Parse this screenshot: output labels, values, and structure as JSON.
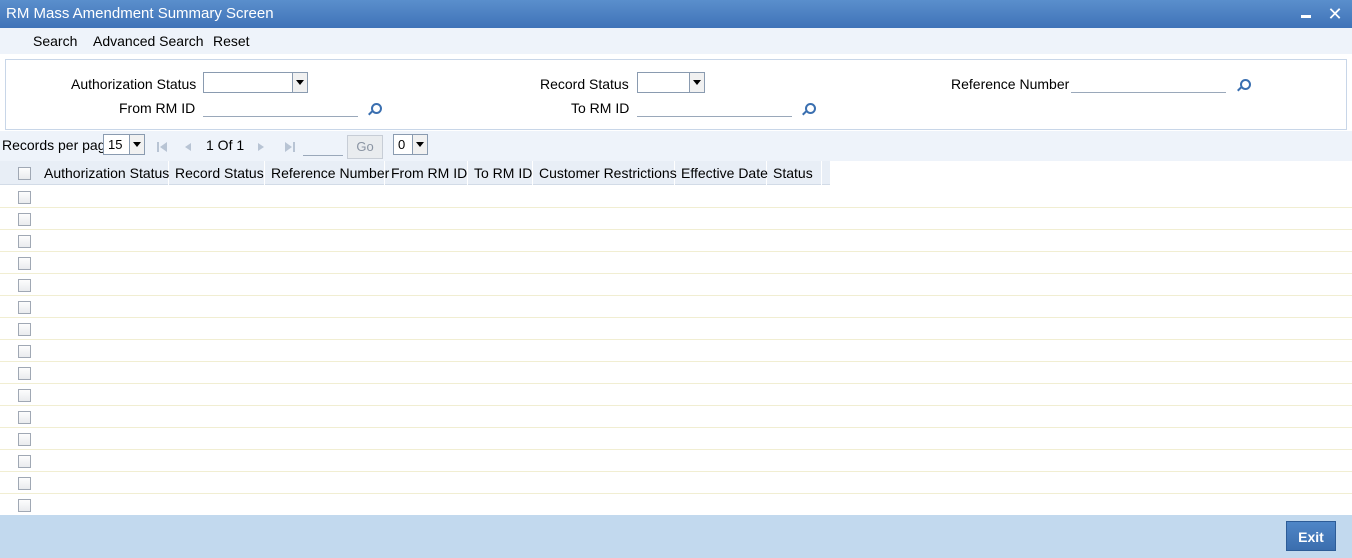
{
  "window": {
    "title": "RM Mass Amendment Summary Screen"
  },
  "menu": {
    "items": [
      "Search",
      "Advanced Search",
      "Reset"
    ]
  },
  "criteria": {
    "authorization_status_label": "Authorization Status",
    "authorization_status_value": "",
    "record_status_label": "Record Status",
    "record_status_value": "",
    "reference_number_label": "Reference Number",
    "reference_number_value": "",
    "from_rm_id_label": "From RM ID",
    "from_rm_id_value": "",
    "to_rm_id_label": "To RM ID",
    "to_rm_id_value": ""
  },
  "pager": {
    "records_per_page_label": "Records per page",
    "records_per_page_value": "15",
    "page_info": "1 Of 1",
    "go_label": "Go",
    "goto_value": "",
    "second_select_value": "0"
  },
  "grid": {
    "columns": [
      "Authorization Status",
      "Record Status",
      "Reference Number",
      "From RM ID",
      "To RM ID",
      "Customer Restrictions",
      "Effective Date",
      "Status"
    ],
    "row_count": 15
  },
  "footer": {
    "exit_label": "Exit"
  }
}
